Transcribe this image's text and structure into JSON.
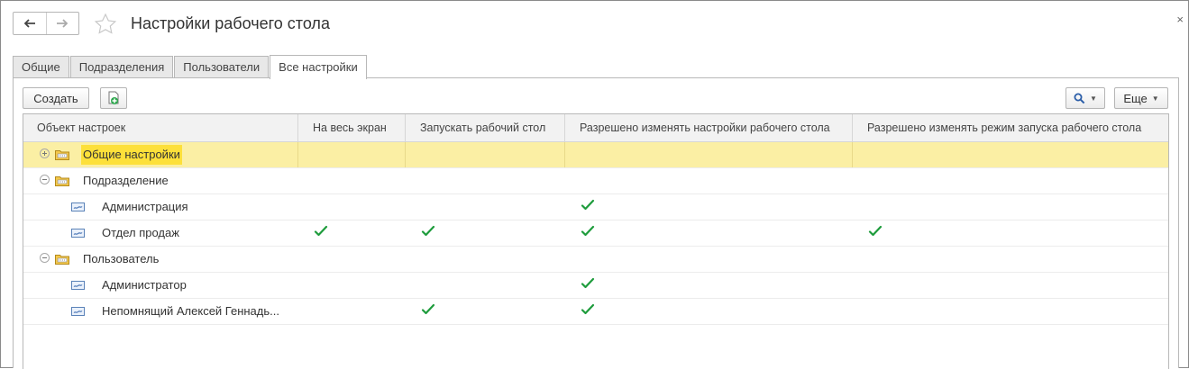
{
  "window": {
    "title": "Настройки рабочего стола",
    "close_glyph": "×"
  },
  "tabs": [
    {
      "label": "Общие",
      "active": false
    },
    {
      "label": "Подразделения",
      "active": false
    },
    {
      "label": "Пользователи",
      "active": false
    },
    {
      "label": "Все настройки",
      "active": true
    }
  ],
  "toolbar": {
    "create_label": "Создать",
    "more_label": "Еще",
    "search_icon": "magnifier-icon",
    "add_copy_icon": "add-copy-icon"
  },
  "grid": {
    "columns": [
      "Объект настроек",
      "На весь экран",
      "Запускать рабочий стол",
      "Разрешено изменять настройки рабочего стола",
      "Разрешено изменять режим запуска рабочего стола"
    ],
    "rows": [
      {
        "label": "Общие настройки",
        "type": "group",
        "expander": "⊕",
        "selected": true,
        "checks": [
          false,
          false,
          false,
          false
        ]
      },
      {
        "label": "Подразделение",
        "type": "group",
        "expander": "⊖",
        "selected": false,
        "checks": [
          false,
          false,
          false,
          false
        ]
      },
      {
        "label": "Администрация",
        "type": "item",
        "selected": false,
        "checks": [
          false,
          false,
          true,
          false
        ]
      },
      {
        "label": "Отдел продаж",
        "type": "item",
        "selected": false,
        "checks": [
          true,
          true,
          true,
          true
        ]
      },
      {
        "label": "Пользователь",
        "type": "group",
        "expander": "⊖",
        "selected": false,
        "checks": [
          false,
          false,
          false,
          false
        ]
      },
      {
        "label": "Администратор",
        "type": "item",
        "selected": false,
        "checks": [
          false,
          false,
          true,
          false
        ]
      },
      {
        "label": "Непомнящий Алексей Геннадь...",
        "type": "item",
        "selected": false,
        "checks": [
          false,
          true,
          true,
          false
        ]
      }
    ]
  },
  "colors": {
    "check": "#1e9c3c",
    "selected_row": "#fbefa4",
    "highlight": "#fde03a"
  }
}
